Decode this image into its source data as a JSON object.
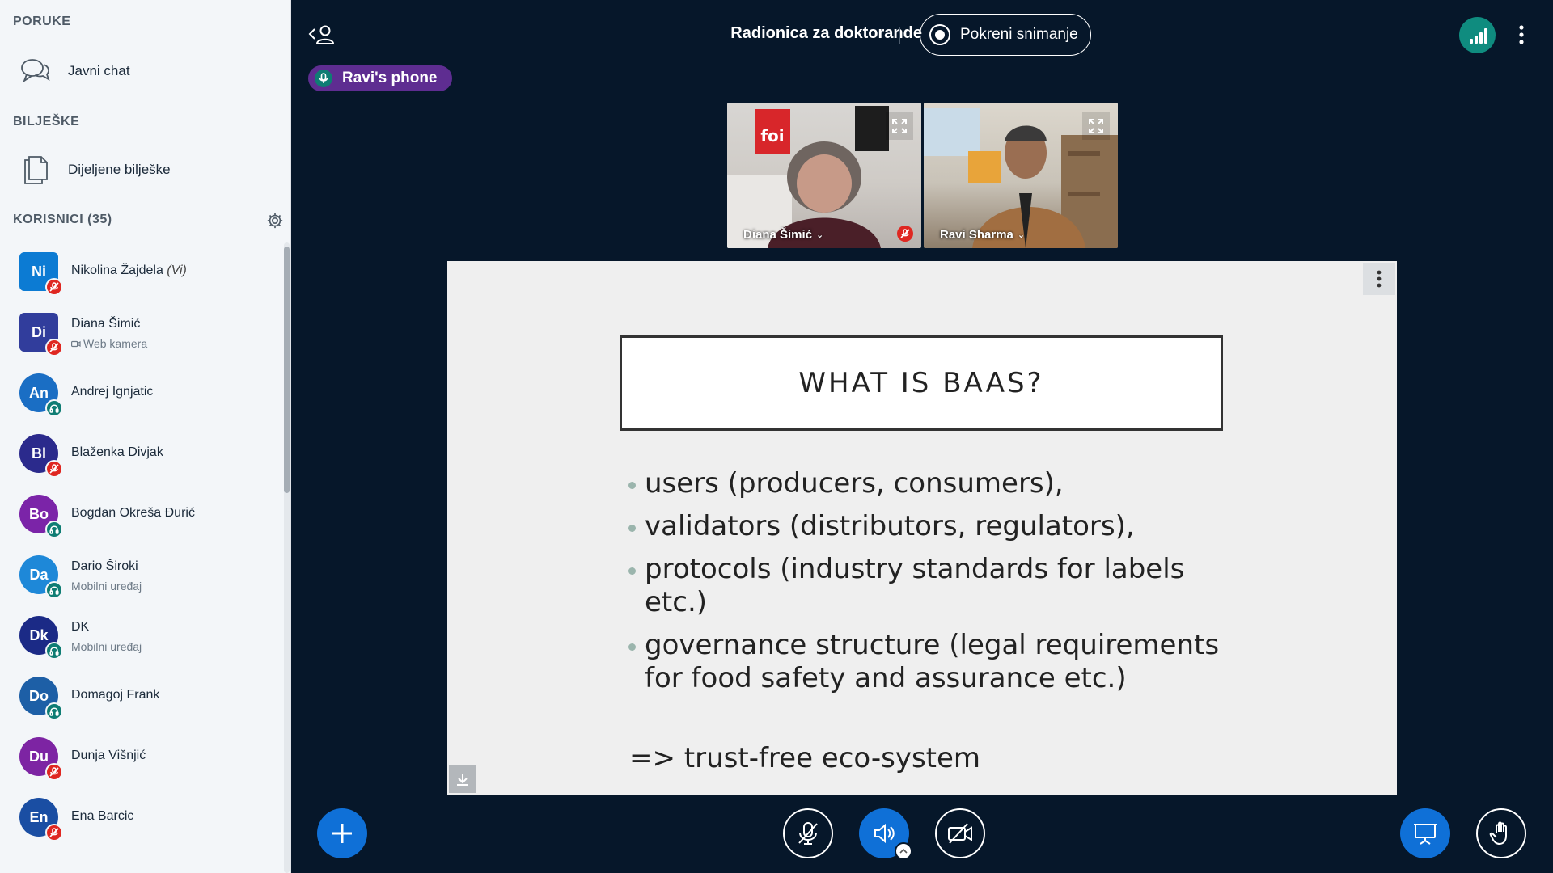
{
  "sidebar": {
    "messages_title": "PORUKE",
    "public_chat": "Javni chat",
    "notes_title": "BILJEŠKE",
    "shared_notes": "Dijeljene bilješke",
    "users_title": "KORISNICI (35)",
    "users": [
      {
        "initials": "Ni",
        "name": "Nikolina Žajdela",
        "suffix": "(Vi)",
        "sub": "",
        "avatar_color": "#0c7bd3",
        "status": "muted",
        "square": true
      },
      {
        "initials": "Di",
        "name": "Diana Šimić",
        "suffix": "",
        "sub": "Web kamera",
        "avatar_color": "#313d9c",
        "status": "muted",
        "square": true
      },
      {
        "initials": "An",
        "name": "Andrej Ignjatic",
        "suffix": "",
        "sub": "",
        "avatar_color": "#1a6ec4",
        "status": "listen",
        "square": false
      },
      {
        "initials": "Bl",
        "name": "Blaženka Divjak",
        "suffix": "",
        "sub": "",
        "avatar_color": "#2b2a8c",
        "status": "muted",
        "square": false
      },
      {
        "initials": "Bo",
        "name": "Bogdan Okreša Đurić",
        "suffix": "",
        "sub": "",
        "avatar_color": "#7b24a8",
        "status": "listen",
        "square": false
      },
      {
        "initials": "Da",
        "name": "Dario Široki",
        "suffix": "",
        "sub": "Mobilni uređaj",
        "avatar_color": "#1e88d8",
        "status": "listen",
        "square": false
      },
      {
        "initials": "Dk",
        "name": "DK",
        "suffix": "",
        "sub": "Mobilni uređaj",
        "avatar_color": "#1b2a86",
        "status": "listen",
        "square": false
      },
      {
        "initials": "Do",
        "name": "Domagoj Frank",
        "suffix": "",
        "sub": "",
        "avatar_color": "#1d5fa6",
        "status": "listen",
        "square": false
      },
      {
        "initials": "Du",
        "name": "Dunja Višnjić",
        "suffix": "",
        "sub": "",
        "avatar_color": "#7d24a3",
        "status": "muted",
        "square": false
      },
      {
        "initials": "En",
        "name": "Ena Barcic",
        "suffix": "",
        "sub": "",
        "avatar_color": "#1a4ea3",
        "status": "muted",
        "square": false
      }
    ]
  },
  "topbar": {
    "meeting_title": "Radionica za doktorande",
    "record_label": "Pokreni snimanje",
    "talking_indicator": "Ravi's phone"
  },
  "videos": [
    {
      "name": "Diana Šimić",
      "chevron": "⌄"
    },
    {
      "name": "Ravi Sharma",
      "chevron": "⌄"
    }
  ],
  "slide": {
    "title": "WHAT IS BAAS?",
    "bullets": [
      "users (producers, consumers),",
      "validators (distributors, regulators),",
      "protocols (industry standards for labels etc.)",
      "governance structure (legal requirements for food safety and assurance etc.)"
    ],
    "conclusion": "=> trust-free eco-system"
  },
  "colors": {
    "background": "#06172a",
    "sidebar": "#f3f6f9",
    "primary_blue": "#0f70d7",
    "muted_red": "#df2721",
    "listen_teal": "#0f7d74",
    "talking_purple": "#5e2d91"
  }
}
